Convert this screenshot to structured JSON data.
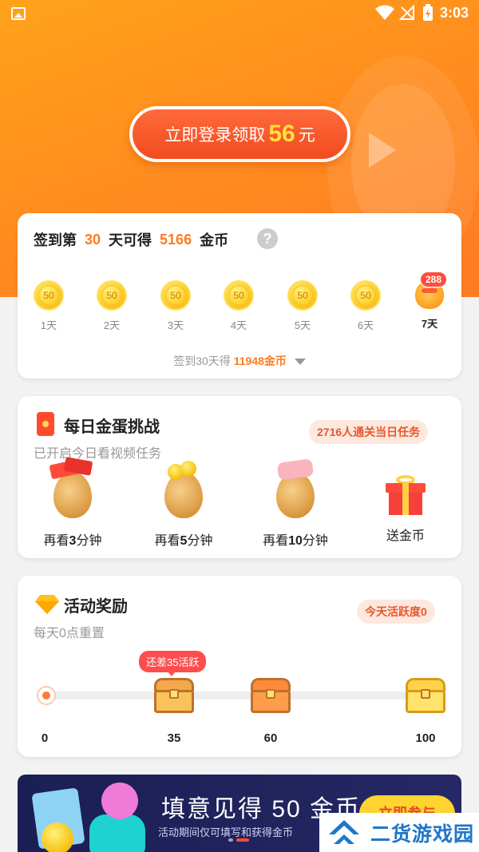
{
  "status_bar": {
    "time": "3:03"
  },
  "hero": {
    "login_prefix": "立即登录领取",
    "login_amount": "56",
    "login_suffix": "元"
  },
  "checkin": {
    "title_pre": "签到第",
    "title_days": "30",
    "title_mid": "天可得",
    "title_coins": "5166",
    "title_suf": "金币",
    "help_icon": "?",
    "days": [
      {
        "label": "1天",
        "coin": "50"
      },
      {
        "label": "2天",
        "coin": "50"
      },
      {
        "label": "3天",
        "coin": "50"
      },
      {
        "label": "4天",
        "coin": "50"
      },
      {
        "label": "5天",
        "coin": "50"
      },
      {
        "label": "6天",
        "coin": "50"
      }
    ],
    "gift_day": {
      "label": "7天",
      "badge": "288"
    },
    "more_pre": "签到30天得",
    "more_value": "11948金币"
  },
  "egg_challenge": {
    "title": "每日金蛋挑战",
    "subtitle": "已开启今日看视频任务",
    "pill": "2716人通关当日任务",
    "items": [
      {
        "pre": "再看",
        "num": "3",
        "suf": "分钟"
      },
      {
        "pre": "再看",
        "num": "5",
        "suf": "分钟"
      },
      {
        "pre": "再看",
        "num": "10",
        "suf": "分钟"
      },
      {
        "pre": "送金币",
        "num": "",
        "suf": ""
      }
    ]
  },
  "activity": {
    "title": "活动奖励",
    "subtitle": "每天0点重置",
    "pill": "今天活跃度0",
    "tooltip": "还差35活跃",
    "milestones": [
      "0",
      "35",
      "60",
      "100"
    ],
    "progress": 0
  },
  "banner": {
    "title": "填意见得 50 金币",
    "subtitle": "活动期间仅可填写和获得金币",
    "cta": "立即参与"
  },
  "watermark": {
    "text": "二货游戏园"
  }
}
